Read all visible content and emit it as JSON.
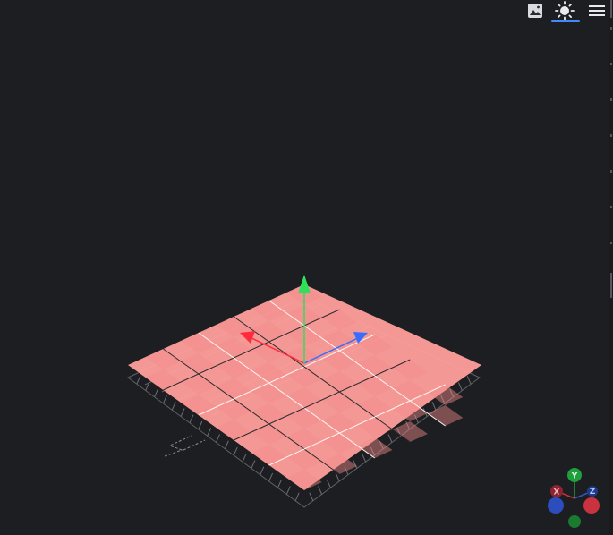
{
  "toolbar": {
    "image_icon": "image-icon",
    "light_icon": "sun-icon",
    "menu_icon": "hamburger-menu-icon",
    "active": "light",
    "accent_color": "#3d8bfd"
  },
  "scene": {
    "background": "#1d1e21",
    "plate_color": "#ff9f9c",
    "axis_colors": {
      "x": "#ff2b3c",
      "y": "#2fe05a",
      "z": "#3a6dff"
    },
    "corner_mark": "Z"
  },
  "gizmo": {
    "labels": {
      "x": "X",
      "y": "Y",
      "z": "Z"
    },
    "colors": {
      "x": "#c9323f",
      "y": "#1f9e3c",
      "z": "#2c56c4",
      "neg_x": "#2c4dbd",
      "neg_y": "#1a7a30"
    }
  }
}
